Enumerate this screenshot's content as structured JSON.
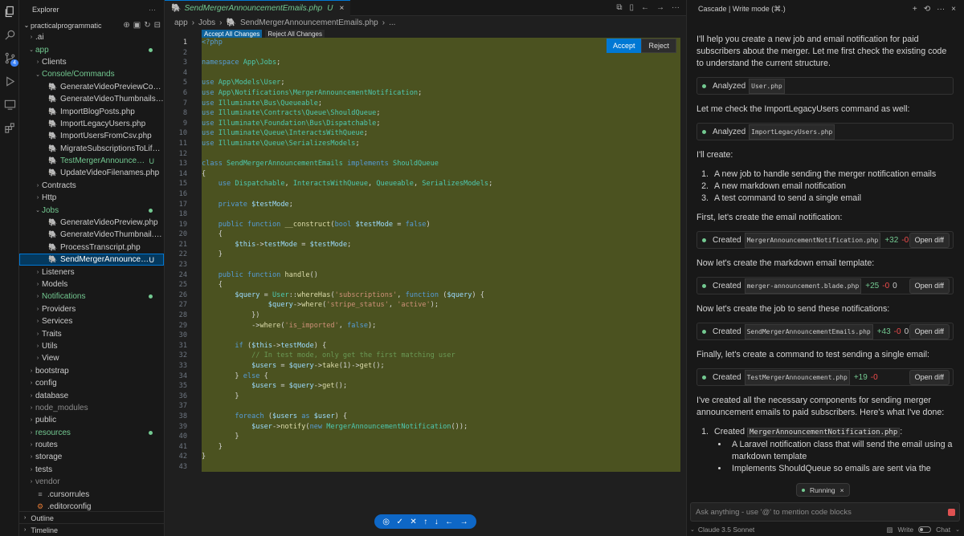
{
  "explorer": {
    "title": "Explorer",
    "project": "practicalprogrammatic",
    "tree": [
      {
        "label": ".ai",
        "depth": 1,
        "type": "folder",
        "open": false
      },
      {
        "label": "app",
        "depth": 1,
        "type": "folder",
        "open": true,
        "status": "dot",
        "green": true
      },
      {
        "label": "Clients",
        "depth": 2,
        "type": "folder",
        "open": false
      },
      {
        "label": "Console/Commands",
        "depth": 2,
        "type": "folder",
        "open": true,
        "green": true
      },
      {
        "label": "GenerateVideoPreviewComman...",
        "depth": 3,
        "type": "php"
      },
      {
        "label": "GenerateVideoThumbnailsCom...",
        "depth": 3,
        "type": "php"
      },
      {
        "label": "ImportBlogPosts.php",
        "depth": 3,
        "type": "php"
      },
      {
        "label": "ImportLegacyUsers.php",
        "depth": 3,
        "type": "php"
      },
      {
        "label": "ImportUsersFromCsv.php",
        "depth": 3,
        "type": "php"
      },
      {
        "label": "MigrateSubscriptionsToLifetime...",
        "depth": 3,
        "type": "php"
      },
      {
        "label": "TestMergerAnnouncement....",
        "depth": 3,
        "type": "php",
        "status": "U",
        "green": true
      },
      {
        "label": "UpdateVideoFilenames.php",
        "depth": 3,
        "type": "php"
      },
      {
        "label": "Contracts",
        "depth": 2,
        "type": "folder",
        "open": false
      },
      {
        "label": "Http",
        "depth": 2,
        "type": "folder",
        "open": false
      },
      {
        "label": "Jobs",
        "depth": 2,
        "type": "folder",
        "open": true,
        "status": "dot",
        "green": true
      },
      {
        "label": "GenerateVideoPreview.php",
        "depth": 3,
        "type": "php"
      },
      {
        "label": "GenerateVideoThumbnail.php",
        "depth": 3,
        "type": "php"
      },
      {
        "label": "ProcessTranscript.php",
        "depth": 3,
        "type": "php"
      },
      {
        "label": "SendMergerAnnouncemen...",
        "depth": 3,
        "type": "php",
        "status": "U",
        "selected": true
      },
      {
        "label": "Listeners",
        "depth": 2,
        "type": "folder",
        "open": false
      },
      {
        "label": "Models",
        "depth": 2,
        "type": "folder",
        "open": false
      },
      {
        "label": "Notifications",
        "depth": 2,
        "type": "folder",
        "open": false,
        "status": "dot",
        "green": true
      },
      {
        "label": "Providers",
        "depth": 2,
        "type": "folder",
        "open": false
      },
      {
        "label": "Services",
        "depth": 2,
        "type": "folder",
        "open": false
      },
      {
        "label": "Traits",
        "depth": 2,
        "type": "folder",
        "open": false
      },
      {
        "label": "Utils",
        "depth": 2,
        "type": "folder",
        "open": false
      },
      {
        "label": "View",
        "depth": 2,
        "type": "folder",
        "open": false
      },
      {
        "label": "bootstrap",
        "depth": 1,
        "type": "folder",
        "open": false
      },
      {
        "label": "config",
        "depth": 1,
        "type": "folder",
        "open": false
      },
      {
        "label": "database",
        "depth": 1,
        "type": "folder",
        "open": false
      },
      {
        "label": "node_modules",
        "depth": 1,
        "type": "folder",
        "open": false,
        "dim": true
      },
      {
        "label": "public",
        "depth": 1,
        "type": "folder",
        "open": false
      },
      {
        "label": "resources",
        "depth": 1,
        "type": "folder",
        "open": false,
        "status": "dot",
        "green": true
      },
      {
        "label": "routes",
        "depth": 1,
        "type": "folder",
        "open": false
      },
      {
        "label": "storage",
        "depth": 1,
        "type": "folder",
        "open": false
      },
      {
        "label": "tests",
        "depth": 1,
        "type": "folder",
        "open": false
      },
      {
        "label": "vendor",
        "depth": 1,
        "type": "folder",
        "open": false,
        "dim": true
      },
      {
        "label": ".cursorrules",
        "depth": 1,
        "type": "txt"
      },
      {
        "label": ".editorconfig",
        "depth": 1,
        "type": "gear"
      }
    ],
    "outline": "Outline",
    "timeline": "Timeline"
  },
  "editor": {
    "tab_label": "SendMergerAnnouncementEmails.php",
    "tab_status": "U",
    "breadcrumb": [
      "app",
      "Jobs",
      "SendMergerAnnouncementEmails.php",
      "..."
    ],
    "accept_all": "Accept All Changes",
    "reject_all": "Reject All Changes",
    "accept": "Accept",
    "reject": "Reject",
    "code": [
      [
        [
          "kw",
          "<?php"
        ]
      ],
      [],
      [
        [
          "kw",
          "namespace "
        ],
        [
          "ns",
          "App\\Jobs"
        ],
        [
          "pu",
          ";"
        ]
      ],
      [],
      [
        [
          "kw",
          "use "
        ],
        [
          "ns",
          "App\\Models\\User"
        ],
        [
          "pu",
          ";"
        ]
      ],
      [
        [
          "kw",
          "use "
        ],
        [
          "ns",
          "App\\Notifications\\MergerAnnouncementNotification"
        ],
        [
          "pu",
          ";"
        ]
      ],
      [
        [
          "kw",
          "use "
        ],
        [
          "ns",
          "Illuminate\\Bus\\Queueable"
        ],
        [
          "pu",
          ";"
        ]
      ],
      [
        [
          "kw",
          "use "
        ],
        [
          "ns",
          "Illuminate\\Contracts\\Queue\\ShouldQueue"
        ],
        [
          "pu",
          ";"
        ]
      ],
      [
        [
          "kw",
          "use "
        ],
        [
          "ns",
          "Illuminate\\Foundation\\Bus\\Dispatchable"
        ],
        [
          "pu",
          ";"
        ]
      ],
      [
        [
          "kw",
          "use "
        ],
        [
          "ns",
          "Illuminate\\Queue\\InteractsWithQueue"
        ],
        [
          "pu",
          ";"
        ]
      ],
      [
        [
          "kw",
          "use "
        ],
        [
          "ns",
          "Illuminate\\Queue\\SerializesModels"
        ],
        [
          "pu",
          ";"
        ]
      ],
      [],
      [
        [
          "kw",
          "class "
        ],
        [
          "ns",
          "SendMergerAnnouncementEmails "
        ],
        [
          "kw",
          "implements "
        ],
        [
          "ns",
          "ShouldQueue"
        ]
      ],
      [
        [
          "pu",
          "{"
        ]
      ],
      [
        [
          "pu",
          "    "
        ],
        [
          "kw",
          "use "
        ],
        [
          "ns",
          "Dispatchable"
        ],
        [
          "pu",
          ", "
        ],
        [
          "ns",
          "InteractsWithQueue"
        ],
        [
          "pu",
          ", "
        ],
        [
          "ns",
          "Queueable"
        ],
        [
          "pu",
          ", "
        ],
        [
          "ns",
          "SerializesModels"
        ],
        [
          "pu",
          ";"
        ]
      ],
      [],
      [
        [
          "pu",
          "    "
        ],
        [
          "kw",
          "private "
        ],
        [
          "var",
          "$testMode"
        ],
        [
          "pu",
          ";"
        ]
      ],
      [],
      [
        [
          "pu",
          "    "
        ],
        [
          "kw",
          "public function "
        ],
        [
          "fn",
          "__construct"
        ],
        [
          "pu",
          "("
        ],
        [
          "kw",
          "bool "
        ],
        [
          "var",
          "$testMode"
        ],
        [
          "pu",
          " = "
        ],
        [
          "kw",
          "false"
        ],
        [
          "pu",
          ")"
        ]
      ],
      [
        [
          "pu",
          "    {"
        ]
      ],
      [
        [
          "pu",
          "        "
        ],
        [
          "var",
          "$this"
        ],
        [
          "pu",
          "->"
        ],
        [
          "var",
          "testMode"
        ],
        [
          "pu",
          " = "
        ],
        [
          "var",
          "$testMode"
        ],
        [
          "pu",
          ";"
        ]
      ],
      [
        [
          "pu",
          "    }"
        ]
      ],
      [],
      [
        [
          "pu",
          "    "
        ],
        [
          "kw",
          "public function "
        ],
        [
          "fn",
          "handle"
        ],
        [
          "pu",
          "()"
        ]
      ],
      [
        [
          "pu",
          "    {"
        ]
      ],
      [
        [
          "pu",
          "        "
        ],
        [
          "var",
          "$query"
        ],
        [
          "pu",
          " = "
        ],
        [
          "ns",
          "User"
        ],
        [
          "pu",
          "::"
        ],
        [
          "fn",
          "whereHas"
        ],
        [
          "pu",
          "("
        ],
        [
          "str",
          "'subscriptions'"
        ],
        [
          "pu",
          ", "
        ],
        [
          "kw",
          "function "
        ],
        [
          "pu",
          "("
        ],
        [
          "var",
          "$query"
        ],
        [
          "pu",
          ") {"
        ]
      ],
      [
        [
          "pu",
          "                "
        ],
        [
          "var",
          "$query"
        ],
        [
          "pu",
          "->"
        ],
        [
          "fn",
          "where"
        ],
        [
          "pu",
          "("
        ],
        [
          "str",
          "'stripe_status'"
        ],
        [
          "pu",
          ", "
        ],
        [
          "str",
          "'active'"
        ],
        [
          "pu",
          ");"
        ]
      ],
      [
        [
          "pu",
          "            })"
        ]
      ],
      [
        [
          "pu",
          "            ->"
        ],
        [
          "fn",
          "where"
        ],
        [
          "pu",
          "("
        ],
        [
          "str",
          "'is_imported'"
        ],
        [
          "pu",
          ", "
        ],
        [
          "kw",
          "false"
        ],
        [
          "pu",
          ");"
        ]
      ],
      [],
      [
        [
          "pu",
          "        "
        ],
        [
          "kw",
          "if "
        ],
        [
          "pu",
          "("
        ],
        [
          "var",
          "$this"
        ],
        [
          "pu",
          "->"
        ],
        [
          "var",
          "testMode"
        ],
        [
          "pu",
          ") {"
        ]
      ],
      [
        [
          "pu",
          "            "
        ],
        [
          "cm",
          "// In test mode, only get the first matching user"
        ]
      ],
      [
        [
          "pu",
          "            "
        ],
        [
          "var",
          "$users"
        ],
        [
          "pu",
          " = "
        ],
        [
          "var",
          "$query"
        ],
        [
          "pu",
          "->"
        ],
        [
          "fn",
          "take"
        ],
        [
          "pu",
          "(1)->"
        ],
        [
          "fn",
          "get"
        ],
        [
          "pu",
          "();"
        ]
      ],
      [
        [
          "pu",
          "        } "
        ],
        [
          "kw",
          "else "
        ],
        [
          "pu",
          "{"
        ]
      ],
      [
        [
          "pu",
          "            "
        ],
        [
          "var",
          "$users"
        ],
        [
          "pu",
          " = "
        ],
        [
          "var",
          "$query"
        ],
        [
          "pu",
          "->"
        ],
        [
          "fn",
          "get"
        ],
        [
          "pu",
          "();"
        ]
      ],
      [
        [
          "pu",
          "        }"
        ]
      ],
      [],
      [
        [
          "pu",
          "        "
        ],
        [
          "kw",
          "foreach "
        ],
        [
          "pu",
          "("
        ],
        [
          "var",
          "$users"
        ],
        [
          "kw",
          " as "
        ],
        [
          "var",
          "$user"
        ],
        [
          "pu",
          ") {"
        ]
      ],
      [
        [
          "pu",
          "            "
        ],
        [
          "var",
          "$user"
        ],
        [
          "pu",
          "->"
        ],
        [
          "fn",
          "notify"
        ],
        [
          "pu",
          "("
        ],
        [
          "kw",
          "new "
        ],
        [
          "ns",
          "MergerAnnouncementNotification"
        ],
        [
          "pu",
          "());"
        ]
      ],
      [
        [
          "pu",
          "        }"
        ]
      ],
      [
        [
          "pu",
          "    }"
        ]
      ],
      [
        [
          "pu",
          "}"
        ]
      ],
      []
    ]
  },
  "cascade": {
    "title": "Cascade | Write mode (⌘.)",
    "intro": "I'll help you create a new job and email notification for paid subscribers about the merger. Let me first check the existing code to understand the current structure.",
    "analyzed_label": "Analyzed",
    "analyzed_1": "User.php",
    "check_text": "Let me check the ImportLegacyUsers command as well:",
    "analyzed_2": "ImportLegacyUsers.php",
    "create_intro": "I'll create:",
    "plan": [
      "A new job to handle sending the merger notification emails",
      "A new markdown email notification",
      "A test command to send a single email"
    ],
    "step1": "First, let's create the email notification:",
    "created_label": "Created",
    "open_diff": "Open diff",
    "created": [
      {
        "file": "MergerAnnouncementNotification.php",
        "plus": "+32",
        "minus": "-0",
        "zero": "0"
      },
      {
        "file": "merger-announcement.blade.php",
        "plus": "+25",
        "minus": "-0",
        "zero": "0"
      },
      {
        "file": "SendMergerAnnouncementEmails.php",
        "plus": "+43",
        "minus": "-0",
        "zero": "0"
      },
      {
        "file": "TestMergerAnnouncement.php",
        "plus": "+19",
        "minus": "-0",
        "zero": "0"
      }
    ],
    "step2": "Now let's create the markdown email template:",
    "step3": "Now let's create the job to send these notifications:",
    "step4": "Finally, let's create a command to test sending a single email:",
    "summary": "I've created all the necessary components for sending merger announcement emails to paid subscribers. Here's what I've done:",
    "summary_item_prefix": "Created",
    "summary_item_file": "MergerAnnouncementNotification.php",
    "bullets": [
      "A Laravel notification class that will send the email using a markdown template",
      "Implements ShouldQueue so emails are sent via the"
    ],
    "running": "Running",
    "input_placeholder": "Ask anything - use '@' to mention code blocks",
    "model": "Claude 3.5 Sonnet",
    "write_label": "Write",
    "chat_label": "Chat"
  },
  "colors": {
    "accent": "#0078d4",
    "added_bg": "#4b5220",
    "git_untracked": "#73c991",
    "php_icon": "#a77bca"
  }
}
